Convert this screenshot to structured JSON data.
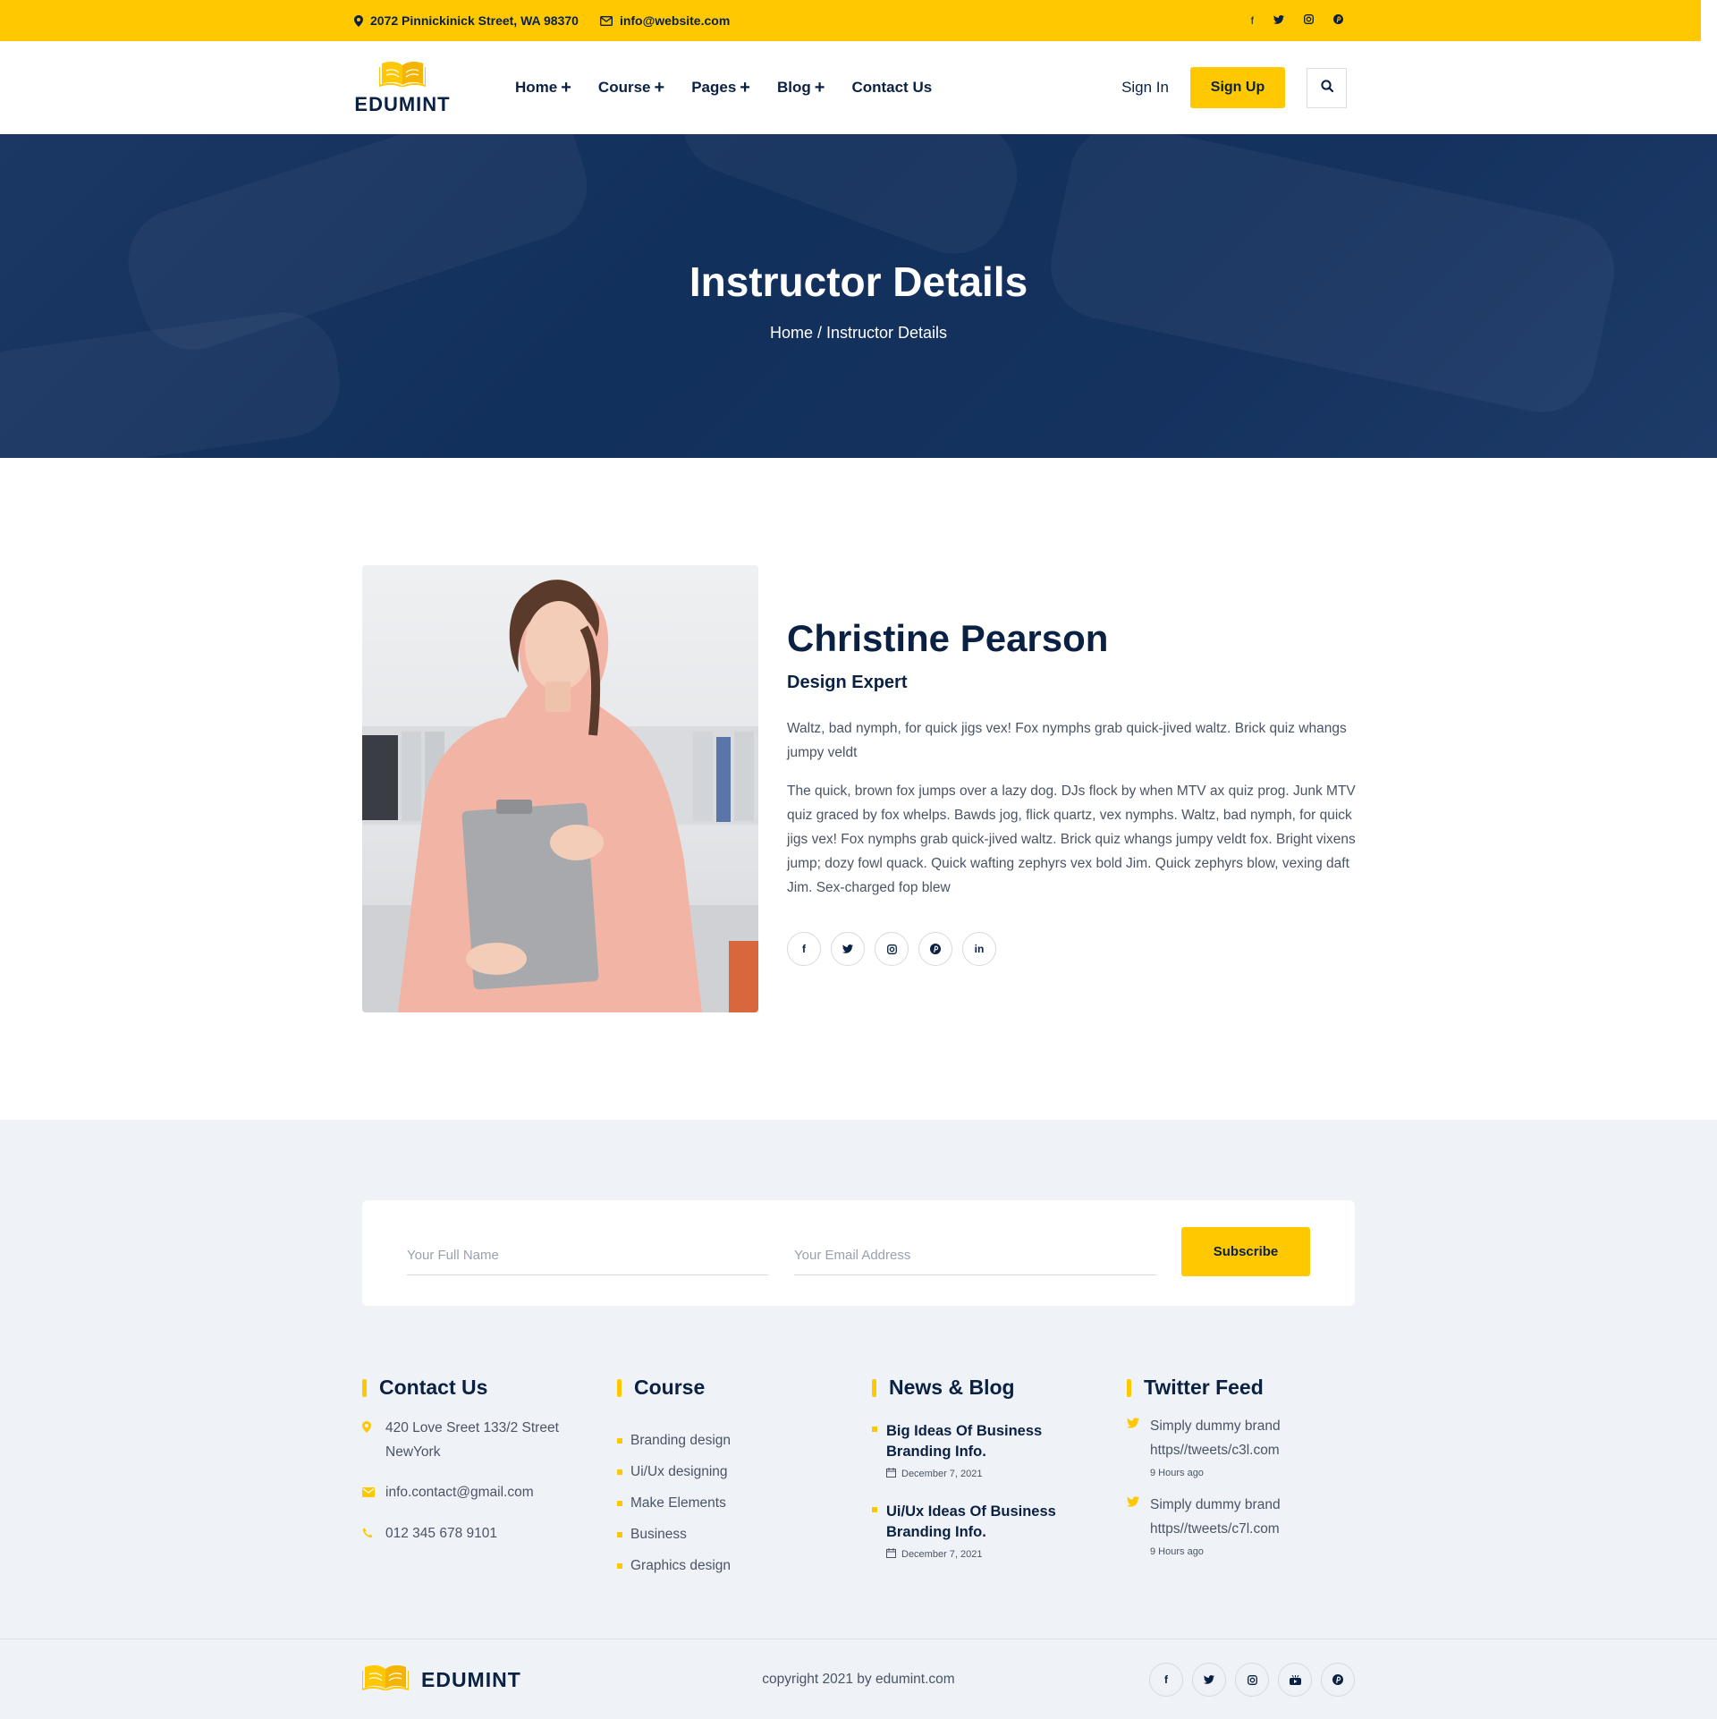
{
  "topbar": {
    "address": "2072 Pinnickinick Street, WA 98370",
    "email": "info@website.com",
    "social_icons": [
      "facebook-icon",
      "twitter-icon",
      "instagram-icon",
      "pinterest-icon"
    ]
  },
  "header": {
    "logo_text": "EDUMINT",
    "nav": [
      {
        "label": "Home",
        "plus": "+"
      },
      {
        "label": "Course",
        "plus": "+"
      },
      {
        "label": "Pages",
        "plus": "+"
      },
      {
        "label": "Blog",
        "plus": "+"
      },
      {
        "label": "Contact Us",
        "plus": ""
      }
    ],
    "signin": "Sign In",
    "signup": "Sign Up"
  },
  "hero": {
    "title": "Instructor Details",
    "breadcrumb_home": "Home",
    "breadcrumb_sep": " / ",
    "breadcrumb_current": "Instructor Details"
  },
  "instructor": {
    "name": "Christine Pearson",
    "role": "Design Expert",
    "bio_1": "Waltz, bad nymph, for quick jigs vex! Fox nymphs grab quick-jived waltz. Brick quiz whangs jumpy veldt",
    "bio_2": "The quick, brown fox jumps over a lazy dog. DJs flock by when MTV ax quiz prog. Junk MTV quiz graced by fox whelps. Bawds jog, flick quartz, vex nymphs. Waltz, bad nymph, for quick jigs vex! Fox nymphs grab quick-jived waltz. Brick quiz whangs jumpy veldt fox. Bright vixens jump; dozy fowl quack. Quick wafting zephyrs vex bold Jim. Quick zephyrs blow, vexing daft Jim. Sex-charged fop blew",
    "social_icons": [
      "facebook-icon",
      "twitter-icon",
      "instagram-icon",
      "pinterest-icon",
      "linkedin-icon"
    ]
  },
  "subscribe": {
    "name_placeholder": "Your Full Name",
    "email_placeholder": "Your Email Address",
    "button": "Subscribe"
  },
  "footer": {
    "contact": {
      "title": "Contact Us",
      "address_line1": "420 Love Sreet 133/2 Street",
      "address_line2": "NewYork",
      "email": "info.contact@gmail.com",
      "phone": "012 345 678 9101"
    },
    "course": {
      "title": "Course",
      "items": [
        "Branding design",
        "Ui/Ux designing",
        "Make Elements",
        "Business",
        "Graphics design"
      ]
    },
    "news": {
      "title": "News & Blog",
      "items": [
        {
          "title": "Big Ideas Of Business Branding Info.",
          "date": "December 7, 2021"
        },
        {
          "title": "Ui/Ux Ideas Of Business Branding Info.",
          "date": "December 7, 2021"
        }
      ]
    },
    "twitter": {
      "title": "Twitter Feed",
      "items": [
        {
          "line1": "Simply dummy brand",
          "line2": "https//tweets/c3l.com",
          "time": "9 Hours ago"
        },
        {
          "line1": "Simply dummy brand",
          "line2": "https//tweets/c7l.com",
          "time": "9 Hours ago"
        }
      ]
    },
    "bottom": {
      "logo_text": "EDUMINT",
      "copyright": "copyright 2021 by edumint.com",
      "social_icons": [
        "facebook-icon",
        "twitter-icon",
        "instagram-icon",
        "youtube-icon",
        "pinterest-icon"
      ]
    }
  },
  "colors": {
    "accent": "#ffc800",
    "navy": "#0b2143",
    "hero_bg": "#15325f",
    "footer_bg": "#eff2f7"
  }
}
